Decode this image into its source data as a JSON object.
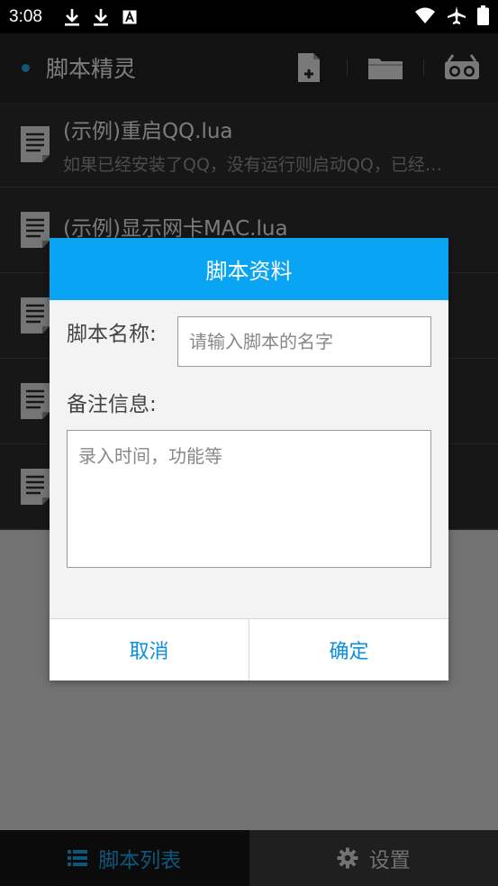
{
  "status_bar": {
    "time": "3:08",
    "icons": [
      "download-icon",
      "download-icon",
      "font-a-icon",
      "wifi-icon",
      "airplane-icon",
      "battery-icon"
    ]
  },
  "toolbar": {
    "title": "脚本精灵",
    "accent": "#1a9fe0",
    "actions": [
      "new-file-icon",
      "folder-icon",
      "record-icon"
    ]
  },
  "scripts": [
    {
      "name": "(示例)重启QQ.lua",
      "desc": "如果已经安装了QQ，没有运行则启动QQ，已经…"
    },
    {
      "name": "(示例)显示网卡MAC.lua",
      "desc": ""
    },
    {
      "name": "",
      "desc": ""
    },
    {
      "name": "",
      "desc": ""
    },
    {
      "name": "",
      "desc": ""
    }
  ],
  "dialog": {
    "title": "脚本资料",
    "name_label": "脚本名称:",
    "name_placeholder": "请输入脚本的名字",
    "name_value": "",
    "note_label": "备注信息:",
    "note_placeholder": "录入时间，功能等",
    "note_value": "",
    "cancel": "取消",
    "confirm": "确定",
    "header_color": "#0aa4f4"
  },
  "bottom_nav": {
    "tab_scripts": "脚本列表",
    "tab_settings": "设置"
  }
}
